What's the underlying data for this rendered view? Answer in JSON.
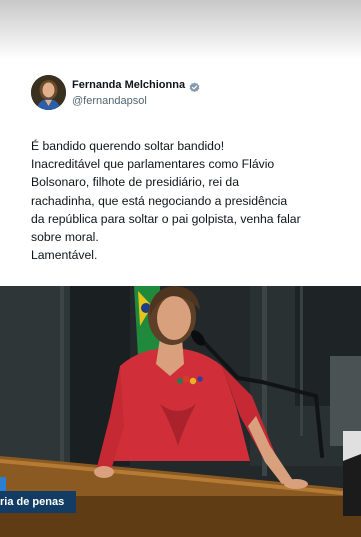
{
  "tweet": {
    "display_name": "Fernanda Melchionna",
    "handle": "@fernandapsol",
    "verified_icon": "verified-badge-icon",
    "text_lines": [
      "É bandido querendo soltar bandido!",
      "Inacreditável que parlamentares como Flávio",
      "Bolsonaro, filhote de presidiário, rei da",
      "rachadinha, que está negociando a presidência",
      "da república para soltar o pai golpista, venha falar",
      "sobre moral.",
      "Lamentável."
    ]
  },
  "video": {
    "caption": "ria de penas"
  },
  "colors": {
    "verified": "#829aab",
    "caption_bg": "#123c63",
    "dress": "#d02f3a"
  }
}
